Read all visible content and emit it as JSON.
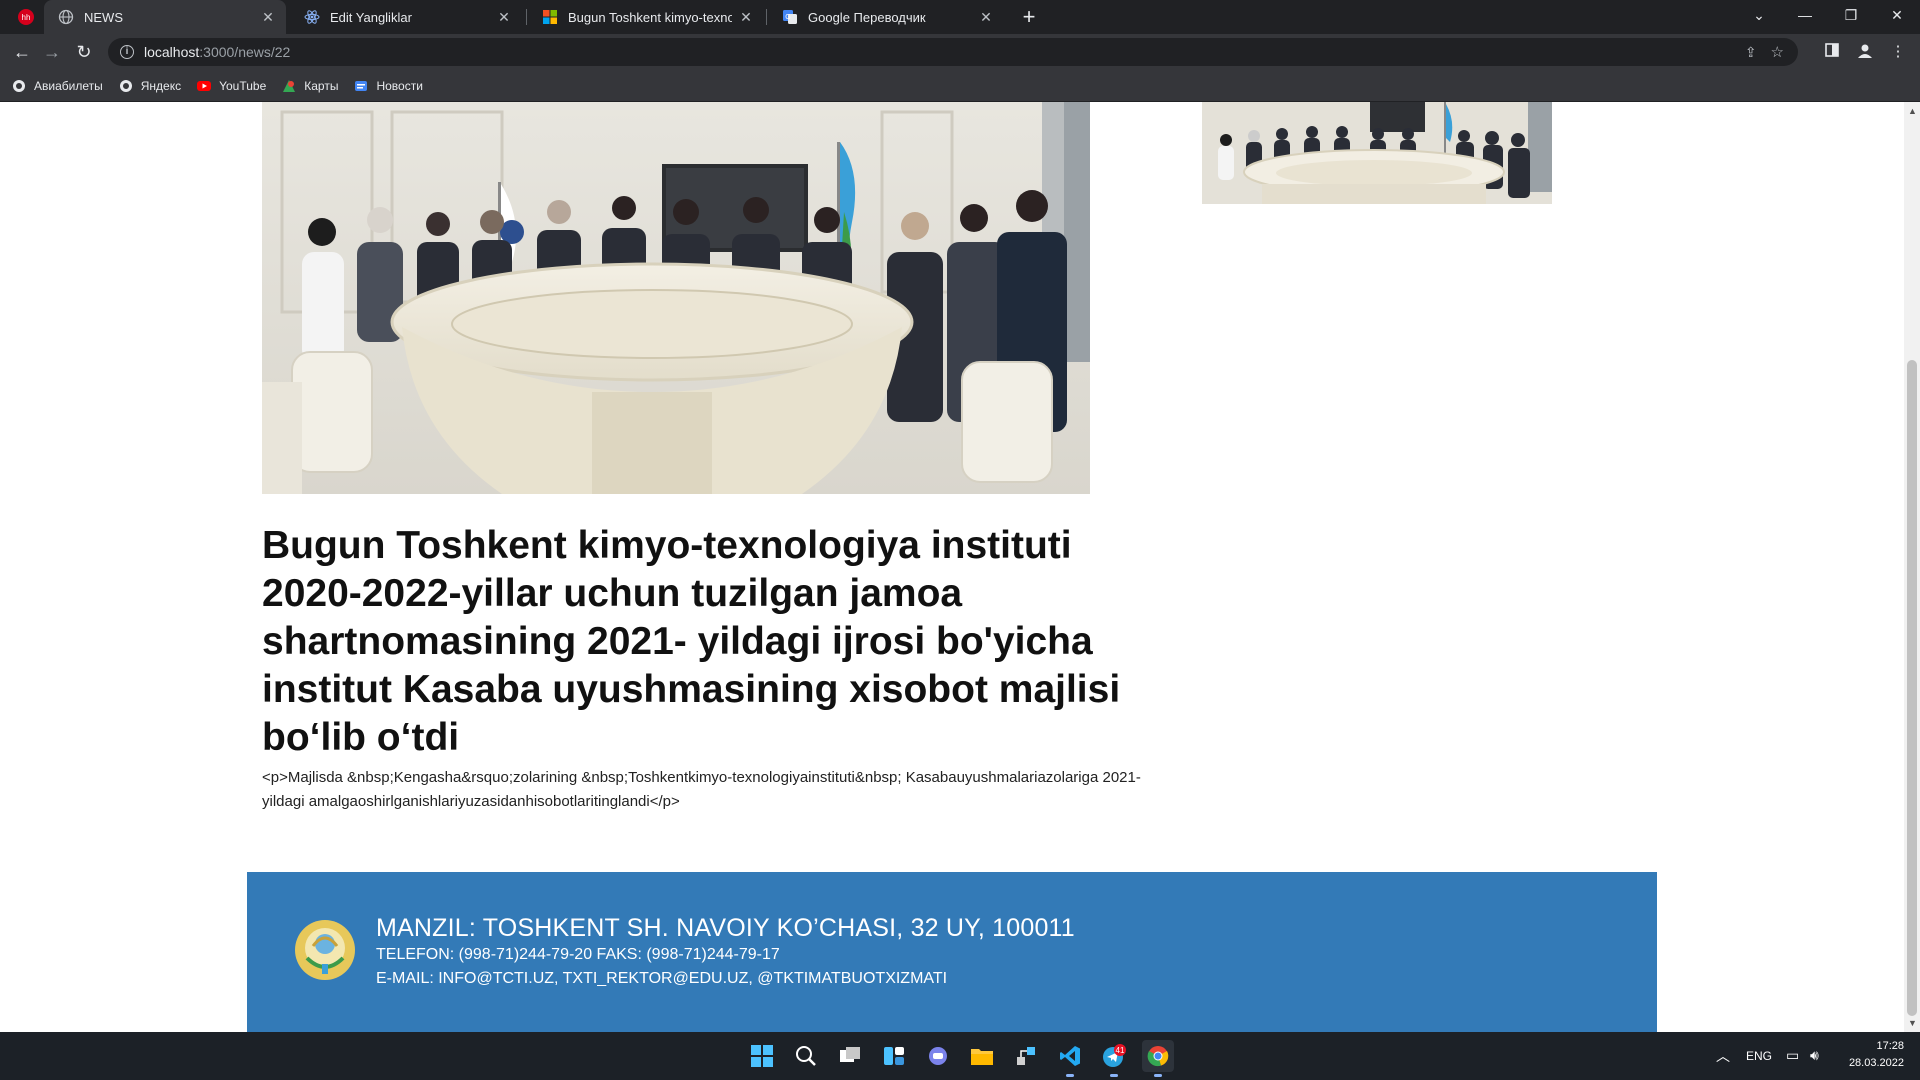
{
  "browser": {
    "tabs": [
      {
        "title": "NEWS",
        "favicon": "globe-icon"
      },
      {
        "title": "Edit Yangliklar",
        "favicon": "react-icon"
      },
      {
        "title": "Bugun Toshkent kimyo-texnologiya",
        "favicon": "microsoft-icon"
      },
      {
        "title": "Google Переводчик",
        "favicon": "google-translate-icon"
      }
    ],
    "url_host": "localhost",
    "url_path": ":3000/news/22",
    "bookmarks": [
      "Авиабилеты",
      "Яндекс",
      "YouTube",
      "Карты",
      "Новости"
    ]
  },
  "article": {
    "title": "Bugun Toshkent kimyo-texnologiya instituti 2020-2022-yillar uchun tuzilgan jamoa shartnomasining 2021- yildagi ijrosi bo'yicha institut Kasaba uyushmasining xisobot majlisi bo‘lib o‘tdi",
    "body": "<p>Majlisda &nbsp;Kengasha&rsquo;zolarining &nbsp;Toshkentkimyo-texnologiyainstituti&nbsp; Kasabauyushmalariazolariga 2021-yildagi amalgaoshirlganishlariyuzasidanhisobotlaritinglandi</p>"
  },
  "footer": {
    "address": "MANZIL: TOSHKENT SH. NAVOIY KO’CHASI, 32 UY, 100011",
    "phone": "TELEFON: (998-71)244-79-20 FAKS: (998-71)244-79-17",
    "email": "E-MAIL: INFO@TCTI.UZ, TXTI_REKTOR@EDU.UZ, @TKTIMATBUOTXIZMATI"
  },
  "taskbar": {
    "language": "ENG",
    "time": "17:28",
    "date": "28.03.2022",
    "telegram_badge": "41"
  },
  "colors": {
    "footer_bg": "#337ab7",
    "chrome_dark": "#202124",
    "chrome_toolbar": "#35363a"
  }
}
